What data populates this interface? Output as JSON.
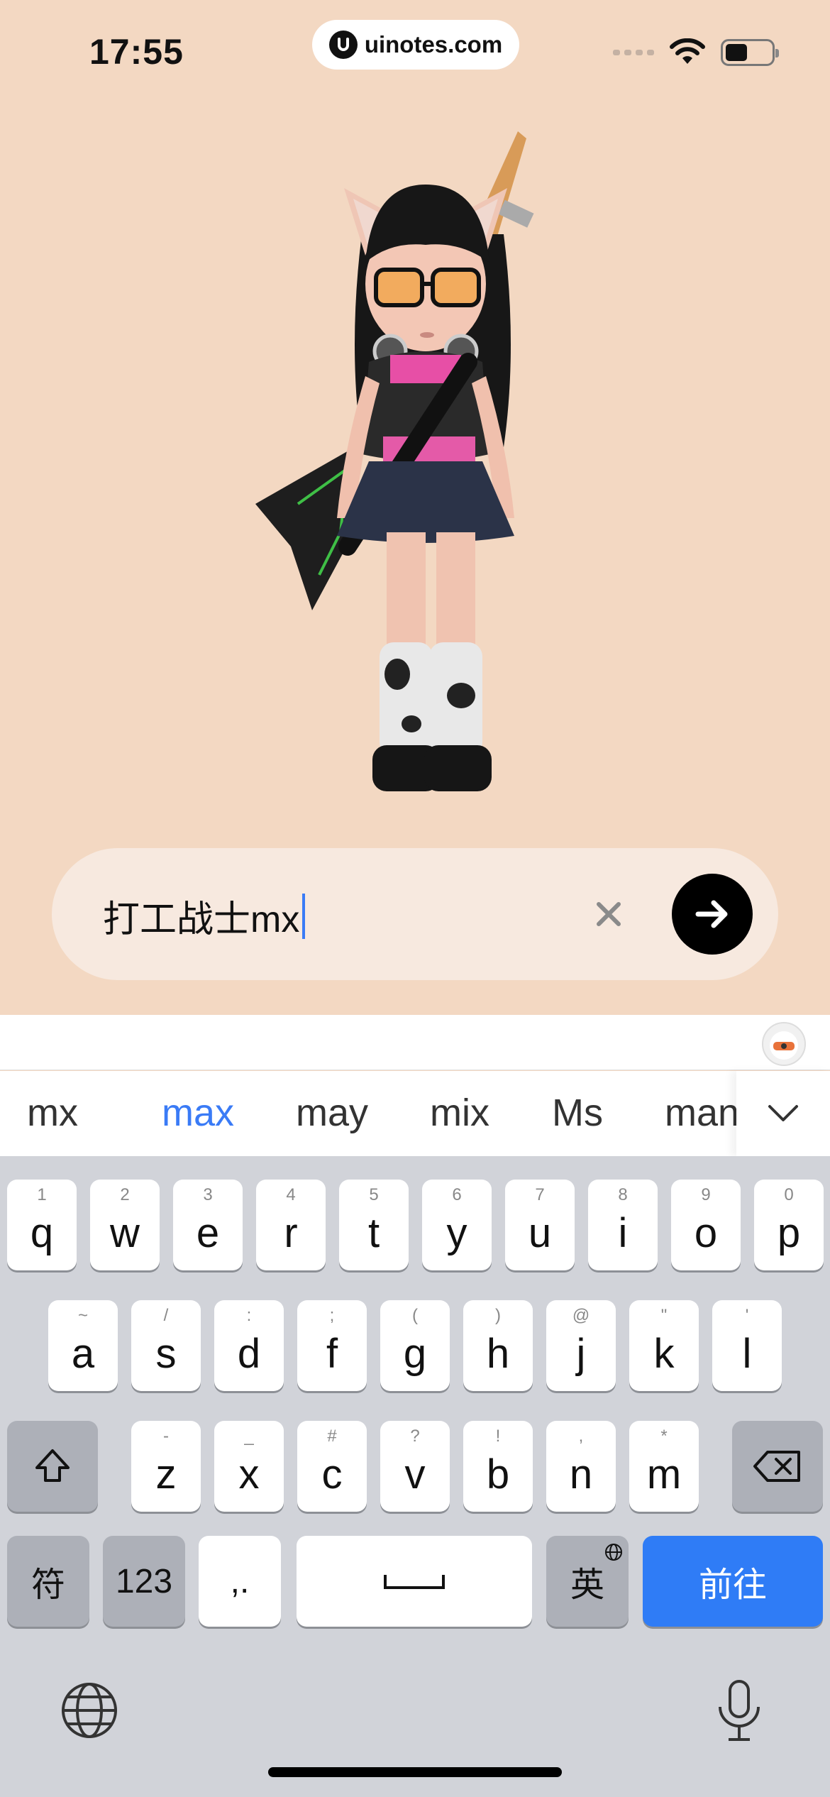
{
  "status_bar": {
    "time": "17:55",
    "url": "uinotes.com"
  },
  "search": {
    "value": "打工战士mx"
  },
  "candidates": [
    {
      "text": "mx",
      "active": false
    },
    {
      "text": "max",
      "active": true
    },
    {
      "text": "may",
      "active": false
    },
    {
      "text": "mix",
      "active": false
    },
    {
      "text": "Ms",
      "active": false
    },
    {
      "text": "man",
      "active": false
    }
  ],
  "keyboard": {
    "row1": [
      {
        "key": "q",
        "hint": "1"
      },
      {
        "key": "w",
        "hint": "2"
      },
      {
        "key": "e",
        "hint": "3"
      },
      {
        "key": "r",
        "hint": "4"
      },
      {
        "key": "t",
        "hint": "5"
      },
      {
        "key": "y",
        "hint": "6"
      },
      {
        "key": "u",
        "hint": "7"
      },
      {
        "key": "i",
        "hint": "8"
      },
      {
        "key": "o",
        "hint": "9"
      },
      {
        "key": "p",
        "hint": "0"
      }
    ],
    "row2": [
      {
        "key": "a",
        "hint": "~"
      },
      {
        "key": "s",
        "hint": "/"
      },
      {
        "key": "d",
        "hint": ":"
      },
      {
        "key": "f",
        "hint": ";"
      },
      {
        "key": "g",
        "hint": "("
      },
      {
        "key": "h",
        "hint": ")"
      },
      {
        "key": "j",
        "hint": "@"
      },
      {
        "key": "k",
        "hint": "\""
      },
      {
        "key": "l",
        "hint": "'"
      }
    ],
    "row3": [
      {
        "key": "z",
        "hint": "-"
      },
      {
        "key": "x",
        "hint": "_"
      },
      {
        "key": "c",
        "hint": "#"
      },
      {
        "key": "v",
        "hint": "?"
      },
      {
        "key": "b",
        "hint": "!"
      },
      {
        "key": "n",
        "hint": ","
      },
      {
        "key": "m",
        "hint": "*"
      }
    ],
    "symbols_label": "符",
    "numbers_label": "123",
    "punct_label": ",.",
    "lang_label": "英",
    "go_label": "前往"
  },
  "colors": {
    "background": "#f3d8c2",
    "accent": "#2f7cf6"
  }
}
